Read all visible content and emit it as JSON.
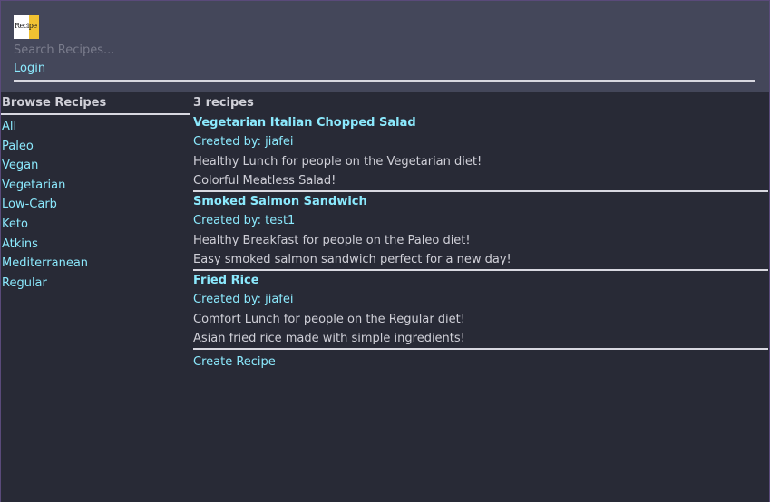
{
  "header": {
    "logo_text": "Recipe",
    "search_placeholder": "Search Recipes...",
    "login_label": "Login"
  },
  "sidebar": {
    "title": "Browse Recipes",
    "items": [
      {
        "label": "All"
      },
      {
        "label": "Paleo"
      },
      {
        "label": "Vegan"
      },
      {
        "label": "Vegetarian"
      },
      {
        "label": "Low-Carb"
      },
      {
        "label": "Keto"
      },
      {
        "label": "Atkins"
      },
      {
        "label": "Mediterranean"
      },
      {
        "label": "Regular"
      }
    ]
  },
  "main": {
    "count_label": "3 recipes",
    "recipes": [
      {
        "title": "Vegetarian Italian Chopped Salad",
        "author": "Created by: jiafei",
        "summary": "Healthy Lunch for people on the Vegetarian diet!",
        "description": "Colorful Meatless Salad!"
      },
      {
        "title": "Smoked Salmon Sandwich",
        "author": "Created by: test1",
        "summary": "Healthy Breakfast for people on the Paleo diet!",
        "description": "Easy smoked salmon sandwich perfect for a new day!"
      },
      {
        "title": "Fried Rice",
        "author": "Created by: jiafei",
        "summary": "Comfort Lunch for people on the Regular diet!",
        "description": "Asian fried rice made with simple ingredients!"
      }
    ],
    "create_label": "Create Recipe"
  },
  "colors": {
    "background": "#282a36",
    "header_bg": "#44475a",
    "link": "#8be9fd",
    "text": "#d0d0d8",
    "logo_accent": "#f1c232"
  }
}
